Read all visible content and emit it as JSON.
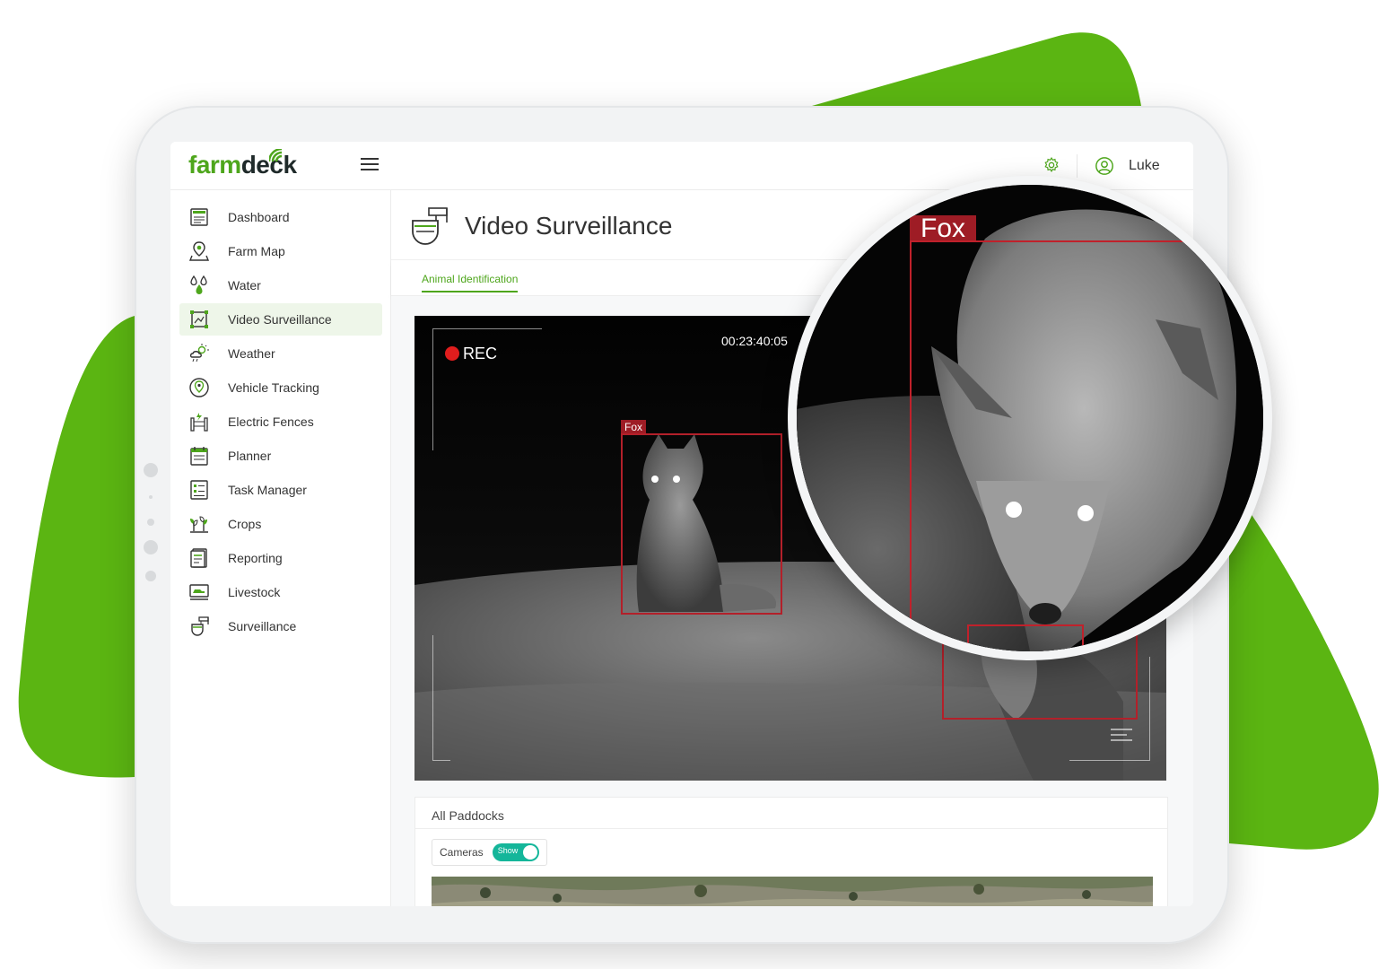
{
  "app": {
    "logo_part1": "farm",
    "logo_part2": "deck",
    "brand_color": "#4ea61c"
  },
  "header": {
    "user_name": "Luke",
    "settings_icon": "gear-icon",
    "user_icon": "user-circle-icon"
  },
  "sidebar": {
    "items": [
      {
        "label": "Dashboard",
        "icon": "dashboard-icon"
      },
      {
        "label": "Farm Map",
        "icon": "map-pin-icon"
      },
      {
        "label": "Water",
        "icon": "water-drops-icon"
      },
      {
        "label": "Video Surveillance",
        "icon": "video-frame-icon",
        "active": true
      },
      {
        "label": "Weather",
        "icon": "weather-icon"
      },
      {
        "label": "Vehicle Tracking",
        "icon": "vehicle-tracking-icon"
      },
      {
        "label": "Electric Fences",
        "icon": "electric-fence-icon"
      },
      {
        "label": "Planner",
        "icon": "calendar-icon"
      },
      {
        "label": "Task Manager",
        "icon": "task-manager-icon"
      },
      {
        "label": "Crops",
        "icon": "crops-icon"
      },
      {
        "label": "Reporting",
        "icon": "report-icon"
      },
      {
        "label": "Livestock",
        "icon": "livestock-icon"
      },
      {
        "label": "Surveillance",
        "icon": "security-camera-icon"
      }
    ]
  },
  "page": {
    "title": "Video Surveillance",
    "title_icon": "security-camera-icon",
    "tabs": [
      {
        "label": "Animal Identification",
        "active": true
      }
    ]
  },
  "video": {
    "rec_label": "REC",
    "timecode": "00:23:40:05",
    "detections": [
      {
        "label": "Fox"
      }
    ],
    "zoom_detection": {
      "label": "Fox"
    }
  },
  "paddocks": {
    "title": "All Paddocks",
    "cameras_label": "Cameras",
    "toggle_label": "Show",
    "toggle_on": true,
    "toggle_color": "#14b69a"
  }
}
